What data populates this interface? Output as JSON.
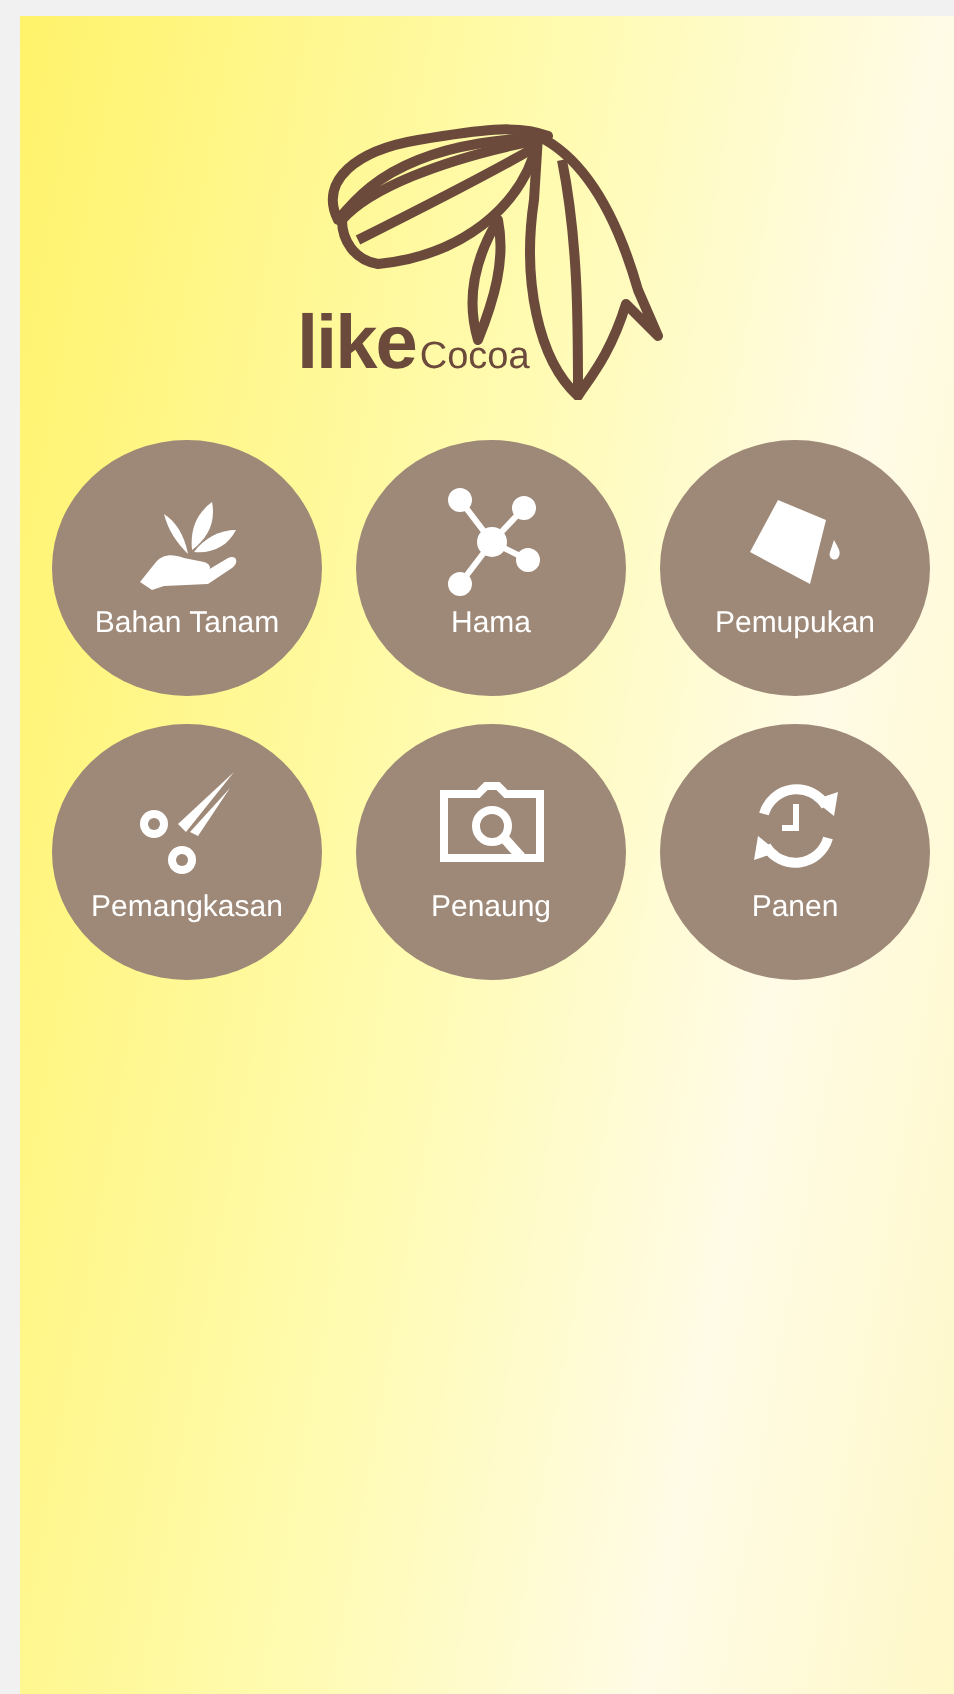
{
  "logo": {
    "brand": "like",
    "name": "Cocoa"
  },
  "menu": [
    {
      "label": "Bahan Tanam"
    },
    {
      "label": "Hama"
    },
    {
      "label": "Pemupukan"
    },
    {
      "label": "Pemangkasan"
    },
    {
      "label": "Penaung"
    },
    {
      "label": "Panen"
    }
  ]
}
